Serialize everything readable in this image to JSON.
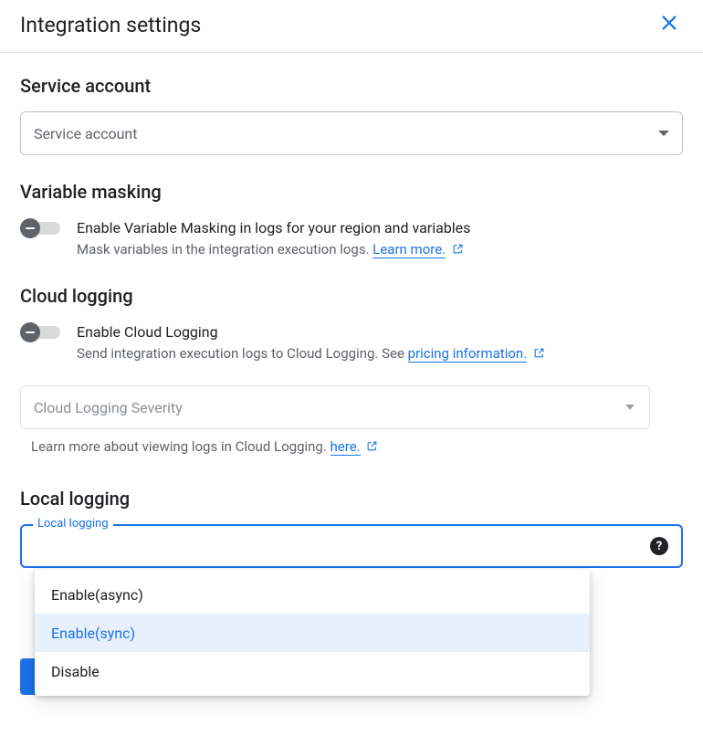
{
  "header": {
    "title": "Integration settings"
  },
  "service_account": {
    "title": "Service account",
    "placeholder": "Service account"
  },
  "variable_masking": {
    "title": "Variable masking",
    "toggle_label": "Enable Variable Masking in logs for your region and variables",
    "description": "Mask variables in the integration execution logs. ",
    "learn_more": "Learn more."
  },
  "cloud_logging": {
    "title": "Cloud logging",
    "toggle_label": "Enable Cloud Logging",
    "description_pre": "Send integration execution logs to Cloud Logging. See ",
    "pricing_link": "pricing information.",
    "severity_placeholder": "Cloud Logging Severity",
    "severity_help_pre": "Learn more about viewing logs in Cloud Logging. ",
    "severity_help_link": "here."
  },
  "local_logging": {
    "title": "Local logging",
    "float_label": "Local logging",
    "options": [
      {
        "label": "Enable(async)"
      },
      {
        "label": "Enable(sync)"
      },
      {
        "label": "Disable"
      }
    ],
    "selected_index": 1
  }
}
